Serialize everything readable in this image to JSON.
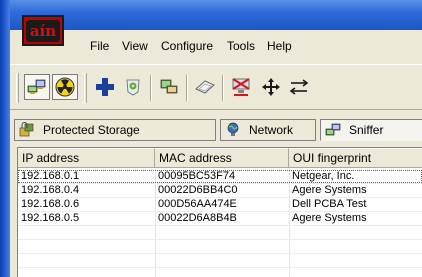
{
  "app": {
    "logo_text": "aín"
  },
  "menu": [
    "File",
    "View",
    "Configure",
    "Tools",
    "Help"
  ],
  "toolbar": {
    "buttons": [
      {
        "icon": "network-computers-icon"
      },
      {
        "icon": "radiation-icon"
      },
      {
        "icon": "add-plus-icon"
      },
      {
        "icon": "certificate-icon"
      },
      {
        "icon": "computers-icon"
      },
      {
        "icon": "password-hash-icon"
      },
      {
        "icon": "arp-poison-icon"
      },
      {
        "icon": "move-arrows-icon"
      },
      {
        "icon": "route-arrows-icon"
      }
    ]
  },
  "tabs": [
    {
      "label": "Protected Storage",
      "icon": "protected-storage-icon"
    },
    {
      "label": "Network",
      "icon": "network-icon"
    },
    {
      "label": "Sniffer",
      "icon": "sniffer-icon"
    }
  ],
  "table": {
    "columns": [
      "IP address",
      "MAC address",
      "OUI fingerprint"
    ],
    "rows": [
      [
        "192.168.0.1",
        "00095BC53F74",
        "Netgear, Inc."
      ],
      [
        "192.168.0.4",
        "00022D6BB4C0",
        "Agere Systems"
      ],
      [
        "192.168.0.6",
        "000D56AA474E",
        "Dell PCBA Test"
      ],
      [
        "192.168.0.5",
        "00022D6A8B4B",
        "Agere Systems"
      ]
    ]
  },
  "colors": {
    "titlebar": "#2f6bd9",
    "logo_red": "#c00000",
    "face": "#ece9d8"
  }
}
